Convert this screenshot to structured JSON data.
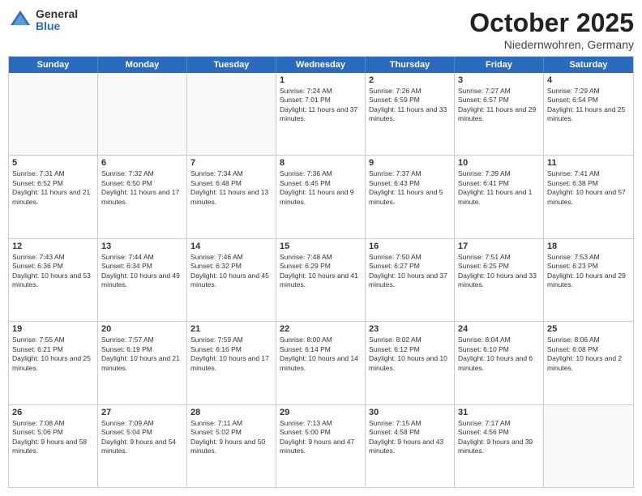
{
  "header": {
    "logo": {
      "general": "General",
      "blue": "Blue"
    },
    "title": "October 2025",
    "subtitle": "Niedernwohren, Germany"
  },
  "days_of_week": [
    "Sunday",
    "Monday",
    "Tuesday",
    "Wednesday",
    "Thursday",
    "Friday",
    "Saturday"
  ],
  "weeks": [
    [
      {
        "day": "",
        "empty": true
      },
      {
        "day": "",
        "empty": true
      },
      {
        "day": "",
        "empty": true
      },
      {
        "day": "1",
        "sunrise": "Sunrise: 7:24 AM",
        "sunset": "Sunset: 7:01 PM",
        "daylight": "Daylight: 11 hours and 37 minutes."
      },
      {
        "day": "2",
        "sunrise": "Sunrise: 7:26 AM",
        "sunset": "Sunset: 6:59 PM",
        "daylight": "Daylight: 11 hours and 33 minutes."
      },
      {
        "day": "3",
        "sunrise": "Sunrise: 7:27 AM",
        "sunset": "Sunset: 6:57 PM",
        "daylight": "Daylight: 11 hours and 29 minutes."
      },
      {
        "day": "4",
        "sunrise": "Sunrise: 7:29 AM",
        "sunset": "Sunset: 6:54 PM",
        "daylight": "Daylight: 11 hours and 25 minutes."
      }
    ],
    [
      {
        "day": "5",
        "sunrise": "Sunrise: 7:31 AM",
        "sunset": "Sunset: 6:52 PM",
        "daylight": "Daylight: 11 hours and 21 minutes."
      },
      {
        "day": "6",
        "sunrise": "Sunrise: 7:32 AM",
        "sunset": "Sunset: 6:50 PM",
        "daylight": "Daylight: 11 hours and 17 minutes."
      },
      {
        "day": "7",
        "sunrise": "Sunrise: 7:34 AM",
        "sunset": "Sunset: 6:48 PM",
        "daylight": "Daylight: 11 hours and 13 minutes."
      },
      {
        "day": "8",
        "sunrise": "Sunrise: 7:36 AM",
        "sunset": "Sunset: 6:45 PM",
        "daylight": "Daylight: 11 hours and 9 minutes."
      },
      {
        "day": "9",
        "sunrise": "Sunrise: 7:37 AM",
        "sunset": "Sunset: 6:43 PM",
        "daylight": "Daylight: 11 hours and 5 minutes."
      },
      {
        "day": "10",
        "sunrise": "Sunrise: 7:39 AM",
        "sunset": "Sunset: 6:41 PM",
        "daylight": "Daylight: 11 hours and 1 minute."
      },
      {
        "day": "11",
        "sunrise": "Sunrise: 7:41 AM",
        "sunset": "Sunset: 6:38 PM",
        "daylight": "Daylight: 10 hours and 57 minutes."
      }
    ],
    [
      {
        "day": "12",
        "sunrise": "Sunrise: 7:43 AM",
        "sunset": "Sunset: 6:36 PM",
        "daylight": "Daylight: 10 hours and 53 minutes."
      },
      {
        "day": "13",
        "sunrise": "Sunrise: 7:44 AM",
        "sunset": "Sunset: 6:34 PM",
        "daylight": "Daylight: 10 hours and 49 minutes."
      },
      {
        "day": "14",
        "sunrise": "Sunrise: 7:46 AM",
        "sunset": "Sunset: 6:32 PM",
        "daylight": "Daylight: 10 hours and 45 minutes."
      },
      {
        "day": "15",
        "sunrise": "Sunrise: 7:48 AM",
        "sunset": "Sunset: 6:29 PM",
        "daylight": "Daylight: 10 hours and 41 minutes."
      },
      {
        "day": "16",
        "sunrise": "Sunrise: 7:50 AM",
        "sunset": "Sunset: 6:27 PM",
        "daylight": "Daylight: 10 hours and 37 minutes."
      },
      {
        "day": "17",
        "sunrise": "Sunrise: 7:51 AM",
        "sunset": "Sunset: 6:25 PM",
        "daylight": "Daylight: 10 hours and 33 minutes."
      },
      {
        "day": "18",
        "sunrise": "Sunrise: 7:53 AM",
        "sunset": "Sunset: 6:23 PM",
        "daylight": "Daylight: 10 hours and 29 minutes."
      }
    ],
    [
      {
        "day": "19",
        "sunrise": "Sunrise: 7:55 AM",
        "sunset": "Sunset: 6:21 PM",
        "daylight": "Daylight: 10 hours and 25 minutes."
      },
      {
        "day": "20",
        "sunrise": "Sunrise: 7:57 AM",
        "sunset": "Sunset: 6:19 PM",
        "daylight": "Daylight: 10 hours and 21 minutes."
      },
      {
        "day": "21",
        "sunrise": "Sunrise: 7:59 AM",
        "sunset": "Sunset: 6:16 PM",
        "daylight": "Daylight: 10 hours and 17 minutes."
      },
      {
        "day": "22",
        "sunrise": "Sunrise: 8:00 AM",
        "sunset": "Sunset: 6:14 PM",
        "daylight": "Daylight: 10 hours and 14 minutes."
      },
      {
        "day": "23",
        "sunrise": "Sunrise: 8:02 AM",
        "sunset": "Sunset: 6:12 PM",
        "daylight": "Daylight: 10 hours and 10 minutes."
      },
      {
        "day": "24",
        "sunrise": "Sunrise: 8:04 AM",
        "sunset": "Sunset: 6:10 PM",
        "daylight": "Daylight: 10 hours and 6 minutes."
      },
      {
        "day": "25",
        "sunrise": "Sunrise: 8:06 AM",
        "sunset": "Sunset: 6:08 PM",
        "daylight": "Daylight: 10 hours and 2 minutes."
      }
    ],
    [
      {
        "day": "26",
        "sunrise": "Sunrise: 7:08 AM",
        "sunset": "Sunset: 5:06 PM",
        "daylight": "Daylight: 9 hours and 58 minutes."
      },
      {
        "day": "27",
        "sunrise": "Sunrise: 7:09 AM",
        "sunset": "Sunset: 5:04 PM",
        "daylight": "Daylight: 9 hours and 54 minutes."
      },
      {
        "day": "28",
        "sunrise": "Sunrise: 7:11 AM",
        "sunset": "Sunset: 5:02 PM",
        "daylight": "Daylight: 9 hours and 50 minutes."
      },
      {
        "day": "29",
        "sunrise": "Sunrise: 7:13 AM",
        "sunset": "Sunset: 5:00 PM",
        "daylight": "Daylight: 9 hours and 47 minutes."
      },
      {
        "day": "30",
        "sunrise": "Sunrise: 7:15 AM",
        "sunset": "Sunset: 4:58 PM",
        "daylight": "Daylight: 9 hours and 43 minutes."
      },
      {
        "day": "31",
        "sunrise": "Sunrise: 7:17 AM",
        "sunset": "Sunset: 4:56 PM",
        "daylight": "Daylight: 9 hours and 39 minutes."
      },
      {
        "day": "",
        "empty": true
      }
    ]
  ]
}
